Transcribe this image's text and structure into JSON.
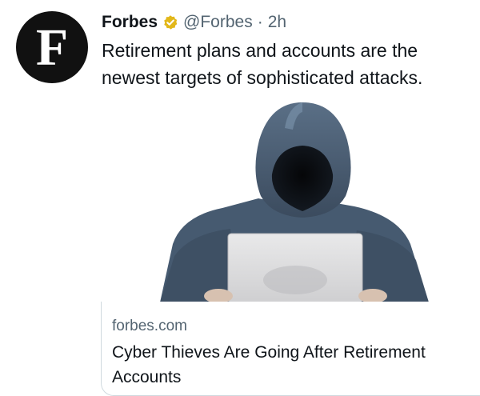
{
  "tweet": {
    "author_name": "Forbes",
    "handle": "@Forbes",
    "separator": "·",
    "time": "2h",
    "avatar_letter": "F",
    "verified_color": "#e2b719",
    "text": "Retirement plans and accounts are the newest targets of sophisticated attacks."
  },
  "media": {
    "icon": "hooded-hacker-laptop-image"
  },
  "card": {
    "domain": "forbes.com",
    "title": "Cyber Thieves Are Going After Retirement Accounts"
  }
}
